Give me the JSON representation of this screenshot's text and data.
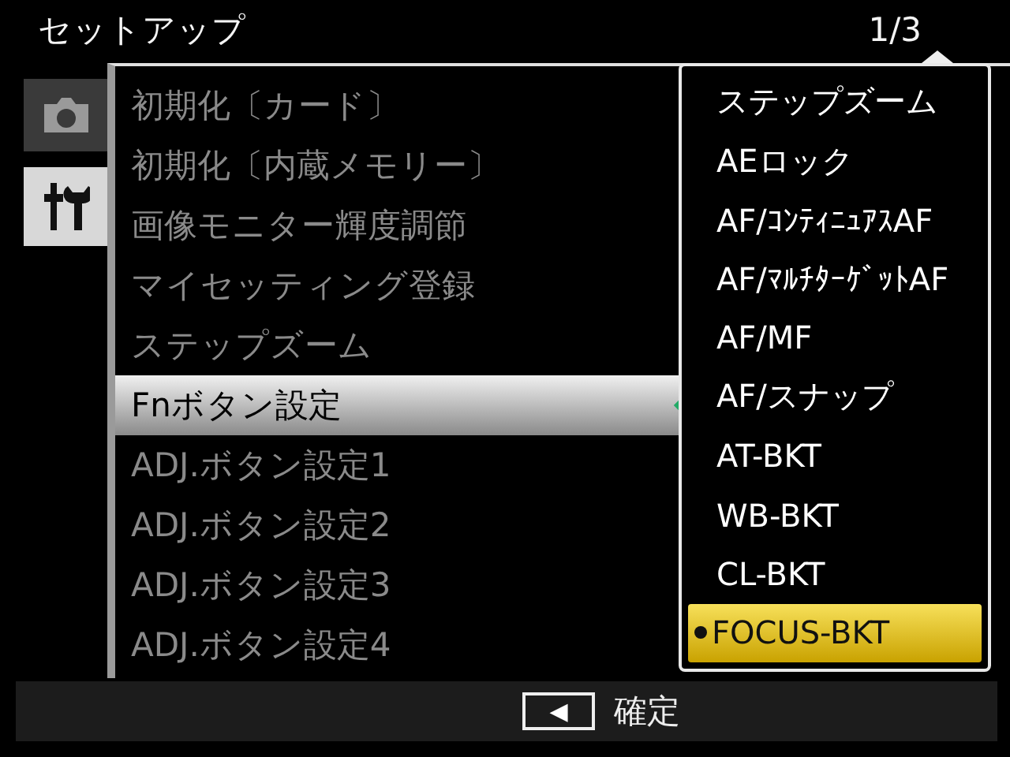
{
  "header": {
    "title": "セットアップ",
    "page": "1/3"
  },
  "tabs": [
    {
      "kind": "camera",
      "selected": false
    },
    {
      "kind": "tools",
      "selected": true
    }
  ],
  "menu": [
    {
      "label": "初期化〔カード〕",
      "selected": false
    },
    {
      "label": "初期化〔内蔵メモリー〕",
      "selected": false
    },
    {
      "label": "画像モニター輝度調節",
      "selected": false
    },
    {
      "label": "マイセッティング登録",
      "selected": false
    },
    {
      "label": "ステップズーム",
      "selected": false
    },
    {
      "label": "Fnボタン設定",
      "selected": true
    },
    {
      "label": "ADJ.ボタン設定1",
      "selected": false
    },
    {
      "label": "ADJ.ボタン設定2",
      "selected": false
    },
    {
      "label": "ADJ.ボタン設定3",
      "selected": false
    },
    {
      "label": "ADJ.ボタン設定4",
      "selected": false
    }
  ],
  "options": [
    {
      "label": "ステップズーム",
      "selected": false
    },
    {
      "label": "AEロック",
      "selected": false
    },
    {
      "label": "AF/ｺﾝﾃｨﾆｭｱｽAF",
      "selected": false
    },
    {
      "label": "AF/ﾏﾙﾁﾀｰｹﾞｯﾄAF",
      "selected": false
    },
    {
      "label": "AF/MF",
      "selected": false
    },
    {
      "label": "AF/スナップ",
      "selected": false
    },
    {
      "label": "AT-BKT",
      "selected": false
    },
    {
      "label": "WB-BKT",
      "selected": false
    },
    {
      "label": "CL-BKT",
      "selected": false
    },
    {
      "label": "FOCUS-BKT",
      "selected": true
    }
  ],
  "footer": {
    "key": "◀",
    "label": "確定"
  }
}
